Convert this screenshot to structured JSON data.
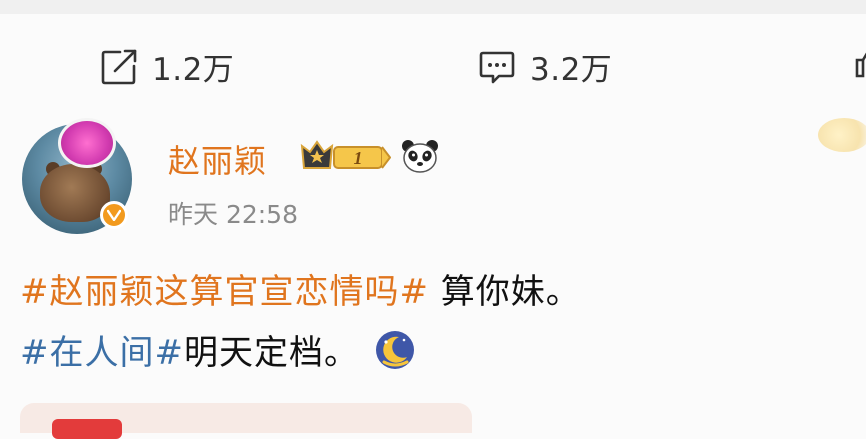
{
  "action_bar": {
    "share": {
      "icon": "share-icon",
      "count": "1.2万"
    },
    "comment": {
      "icon": "comment-icon",
      "count": "3.2万"
    },
    "like": {
      "icon": "like-icon"
    }
  },
  "post": {
    "author": {
      "name": "赵丽颖",
      "vip_level": "1",
      "verified": true,
      "badge_icons": [
        "crown-vip-badge",
        "panda-icon"
      ]
    },
    "timestamp": "昨天 22:58",
    "lines": [
      {
        "topic": "#赵丽颖这算官宣恋情吗#",
        "text": " 算你妹。"
      },
      {
        "topic": "#在人间#",
        "text": "明天定档。",
        "emoji": "moon-emoji"
      }
    ]
  },
  "colors": {
    "accent_orange": "#e0751e",
    "topic_blue": "#3b6fa6",
    "text": "#111111",
    "muted": "#8a8a8a"
  }
}
